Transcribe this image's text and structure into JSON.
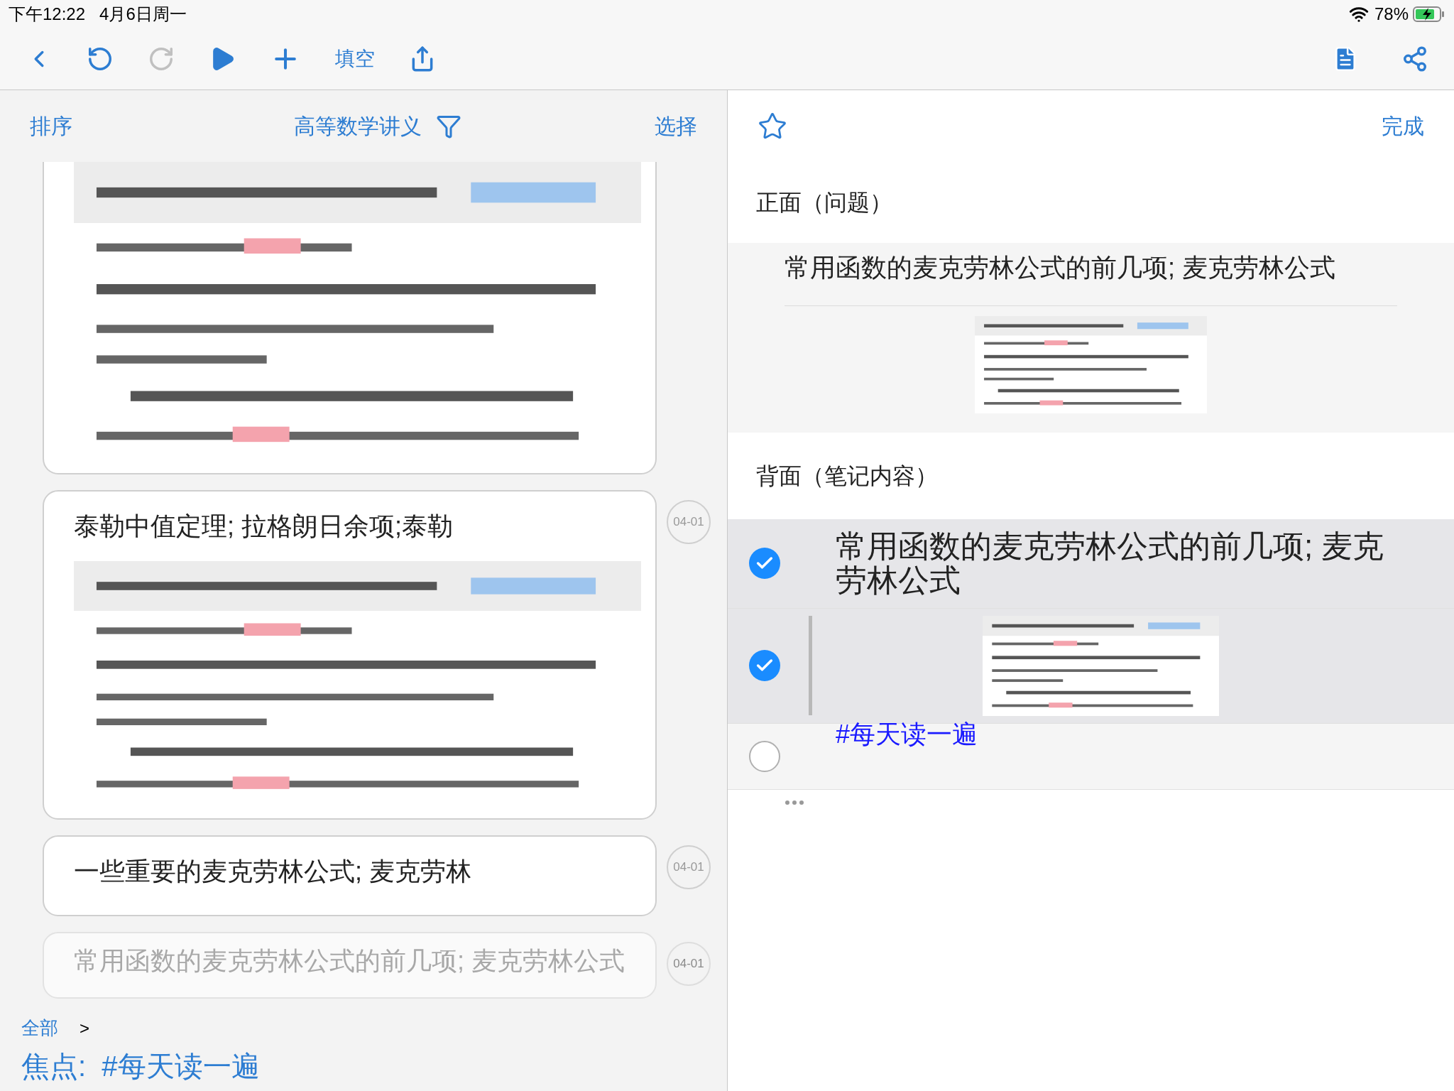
{
  "status_bar": {
    "time": "下午12:22",
    "date": "4月6日周一",
    "battery": "78%",
    "charging": true
  },
  "toolbar": {
    "items": [
      {
        "kind": "back",
        "disabled": false
      },
      {
        "kind": "undo",
        "disabled": false
      },
      {
        "kind": "redo",
        "disabled": true
      },
      {
        "kind": "play",
        "disabled": false
      },
      {
        "kind": "add",
        "disabled": false
      },
      {
        "kind": "text",
        "label": "填空",
        "disabled": false
      },
      {
        "kind": "share",
        "disabled": false
      }
    ],
    "right_items": [
      {
        "kind": "document"
      },
      {
        "kind": "mindmap"
      }
    ]
  },
  "left": {
    "sort": "排序",
    "title": "高等数学讲义",
    "select": "选择",
    "cards": [
      {
        "picture": {
          "kind": "picture"
        },
        "faded": false
      },
      {
        "title": "泰勒中值定理; 拉格朗日余项;泰勒",
        "date": "04-01",
        "picture": {
          "kind": "picture"
        },
        "faded": false
      },
      {
        "title": "一些重要的麦克劳林公式; 麦克劳林",
        "date": "04-01",
        "faded": false
      },
      {
        "title": "常用函数的麦克劳林公式的前几项; 麦克劳林公式",
        "date": "04-01",
        "faded": true
      }
    ],
    "bottom": {
      "scope": "全部",
      "chevron": ">",
      "focus": "焦点:  #每天读一遍"
    }
  },
  "right": {
    "starred": false,
    "done": "完成",
    "front_label": "正面（问题）",
    "front": {
      "text": "常用函数的麦克劳林公式的前几项; 麦克劳林公式",
      "picture": {
        "kind": "picture"
      }
    },
    "back_label": "背面（笔记内容）",
    "items": [
      {
        "kind": "text",
        "checked": true,
        "selected": true,
        "text": "常用函数的麦克劳林公式的前几项; 麦克劳林公式"
      },
      {
        "kind": "picture",
        "checked": true,
        "selected": true
      },
      {
        "kind": "tag",
        "checked": false,
        "selected": false,
        "text": "#每天读一遍"
      }
    ]
  }
}
